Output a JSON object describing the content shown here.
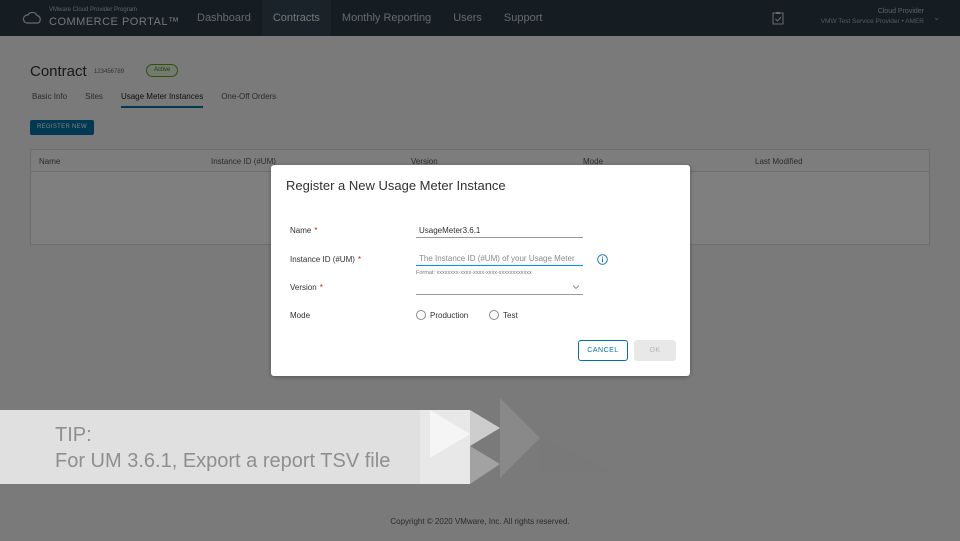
{
  "header": {
    "brand_small": "VMware Cloud Provider Program",
    "brand_big": "COMMERCE PORTAL™",
    "nav": [
      "Dashboard",
      "Contracts",
      "Monthly Reporting",
      "Users",
      "Support"
    ],
    "active_nav": "Contracts",
    "role": "Cloud Provider",
    "org": "VMW Test Service Provider • AMER"
  },
  "page": {
    "title": "Contract",
    "contract_number": "123456789",
    "status": "Active",
    "tabs": [
      "Basic Info",
      "Sites",
      "Usage Meter Instances",
      "One-Off Orders"
    ],
    "active_tab": "Usage Meter Instances",
    "register_button": "REGISTER NEW",
    "grid_columns": [
      "Name",
      "Instance ID (#UM)",
      "Version",
      "Mode",
      "Last Modified"
    ],
    "footer": "Copyright © 2020 VMware, Inc. All rights reserved."
  },
  "modal": {
    "title": "Register a New Usage Meter Instance",
    "name_label": "Name",
    "name_value": "UsageMeter3.6.1",
    "instance_label": "Instance ID (#UM)",
    "instance_placeholder": "The Instance ID (#UM) of your Usage Meter",
    "instance_format": "Format: xxxxxxxx-xxxx-xxxx-xxxx-xxxxxxxxxxxx",
    "version_label": "Version",
    "version_value": "",
    "mode_label": "Mode",
    "mode_options": [
      "Production",
      "Test"
    ],
    "required_mark": "*",
    "cancel": "CANCEL",
    "ok": "OK"
  },
  "tip": {
    "label": "TIP:",
    "text": "For UM 3.6.1, Export a report TSV file"
  },
  "colors": {
    "header_bg": "#2b3a45",
    "accent": "#0072a3",
    "active_status": "#5aa220"
  }
}
